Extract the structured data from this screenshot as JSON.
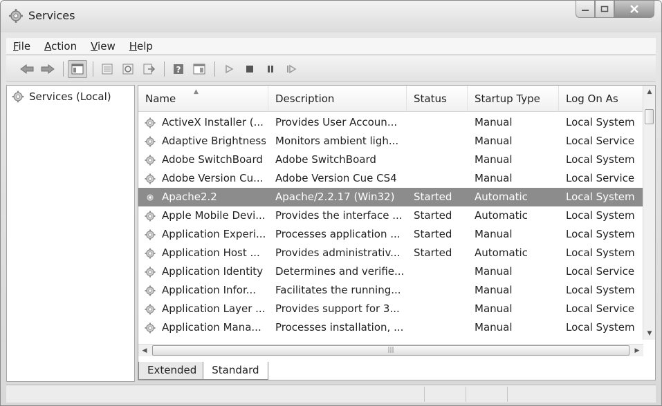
{
  "window": {
    "title": "Services",
    "title_icon": "services-gear-icon"
  },
  "menu": [
    {
      "label": "File"
    },
    {
      "label": "Action"
    },
    {
      "label": "View"
    },
    {
      "label": "Help"
    }
  ],
  "toolbar": {
    "buttons": [
      "back-arrow-icon",
      "forward-arrow-icon",
      "show-hide-console-tree-icon",
      "properties-icon",
      "refresh-icon",
      "export-list-icon",
      "help-icon",
      "show-action-pane-icon",
      "start-service-icon",
      "stop-service-icon",
      "pause-service-icon",
      "restart-service-icon"
    ]
  },
  "tree": {
    "root_label": "Services (Local)"
  },
  "columns": {
    "name": "Name",
    "description": "Description",
    "status": "Status",
    "startup": "Startup Type",
    "logon": "Log On As"
  },
  "rows": [
    {
      "name": "ActiveX Installer (...",
      "description": "Provides User Accoun...",
      "status": "",
      "startup": "Manual",
      "logon": "Local System"
    },
    {
      "name": "Adaptive Brightness",
      "description": "Monitors ambient ligh...",
      "status": "",
      "startup": "Manual",
      "logon": "Local Service"
    },
    {
      "name": "Adobe SwitchBoard",
      "description": "Adobe SwitchBoard",
      "status": "",
      "startup": "Manual",
      "logon": "Local System"
    },
    {
      "name": "Adobe Version Cu...",
      "description": "Adobe Version Cue CS4",
      "status": "",
      "startup": "Manual",
      "logon": "Local Service"
    },
    {
      "name": "Apache2.2",
      "description": "Apache/2.2.17 (Win32)",
      "status": "Started",
      "startup": "Automatic",
      "logon": "Local System",
      "selected": true
    },
    {
      "name": "Apple Mobile Devi...",
      "description": "Provides the interface ...",
      "status": "Started",
      "startup": "Automatic",
      "logon": "Local System"
    },
    {
      "name": "Application Experi...",
      "description": "Processes application ...",
      "status": "Started",
      "startup": "Manual",
      "logon": "Local System"
    },
    {
      "name": "Application Host ...",
      "description": "Provides administrativ...",
      "status": "Started",
      "startup": "Automatic",
      "logon": "Local System"
    },
    {
      "name": "Application Identity",
      "description": "Determines and verifie...",
      "status": "",
      "startup": "Manual",
      "logon": "Local Service"
    },
    {
      "name": "Application Infor...",
      "description": "Facilitates the running...",
      "status": "",
      "startup": "Manual",
      "logon": "Local System"
    },
    {
      "name": "Application Layer ...",
      "description": "Provides support for 3...",
      "status": "",
      "startup": "Manual",
      "logon": "Local Service"
    },
    {
      "name": "Application Mana...",
      "description": "Processes installation, ...",
      "status": "",
      "startup": "Manual",
      "logon": "Local System"
    }
  ],
  "tabs": [
    {
      "label": "Extended"
    },
    {
      "label": "Standard",
      "active": true
    }
  ],
  "colors": {
    "selected_row": "#8c8c8c"
  }
}
